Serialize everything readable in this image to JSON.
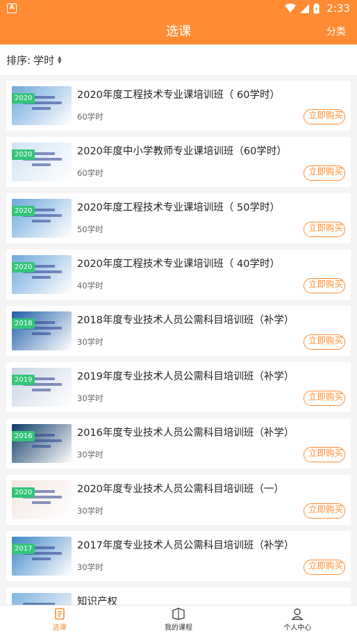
{
  "status_bar": {
    "time": "2:33"
  },
  "header": {
    "title": "选课",
    "action": "分类"
  },
  "sort": {
    "label": "排序:",
    "value": "学时"
  },
  "courses": [
    {
      "title": "2020年度工程技术专业课培训班（ 60学时）",
      "hours": "60学时",
      "year": "2020",
      "buy_label": "立即购买",
      "thumb_color": "#6fa8dc"
    },
    {
      "title": "2020年度中小学教师专业课培训班（60学时）",
      "hours": "60学时",
      "year": "2020",
      "buy_label": "立即购买",
      "thumb_color": "#cfe2f3"
    },
    {
      "title": "2020年度工程技术专业课培训班（ 50学时）",
      "hours": "50学时",
      "year": "2020",
      "buy_label": "立即购买",
      "thumb_color": "#6fa8dc"
    },
    {
      "title": "2020年度工程技术专业课培训班（ 40学时）",
      "hours": "40学时",
      "year": "2020",
      "buy_label": "立即购买",
      "thumb_color": "#6fa8dc"
    },
    {
      "title": "2018年度专业技术人员公需科目培训班（补学）",
      "hours": "30学时",
      "year": "2018",
      "buy_label": "立即购买",
      "thumb_color": "#1f5fa8"
    },
    {
      "title": "2019年度专业技术人员公需科目培训班（补学）",
      "hours": "30学时",
      "year": "2019",
      "buy_label": "立即购买",
      "thumb_color": "#c8d4e4"
    },
    {
      "title": "2016年度专业技术人员公需科目培训班（补学）",
      "hours": "30学时",
      "year": "2016",
      "buy_label": "立即购买",
      "thumb_color": "#0d3b66"
    },
    {
      "title": "2020年度专业技术人员公需科目培训班（一）",
      "hours": "30学时",
      "year": "2020",
      "buy_label": "立即购买",
      "thumb_color": "#f2e6e0"
    },
    {
      "title": "2017年度专业技术人员公需科目培训班（补学）",
      "hours": "30学时",
      "year": "2017",
      "buy_label": "立即购买",
      "thumb_color": "#3d85c6"
    },
    {
      "title": "知识产权",
      "hours": "",
      "year": "",
      "buy_label": "",
      "thumb_color": "#7fb3e0"
    }
  ],
  "tabs": [
    {
      "label": "选课",
      "icon": "course-select-icon",
      "active": true
    },
    {
      "label": "我的课程",
      "icon": "book-icon",
      "active": false
    },
    {
      "label": "个人中心",
      "icon": "person-icon",
      "active": false
    }
  ],
  "colors": {
    "accent": "#ff8c33",
    "badge": "#33c57a"
  }
}
